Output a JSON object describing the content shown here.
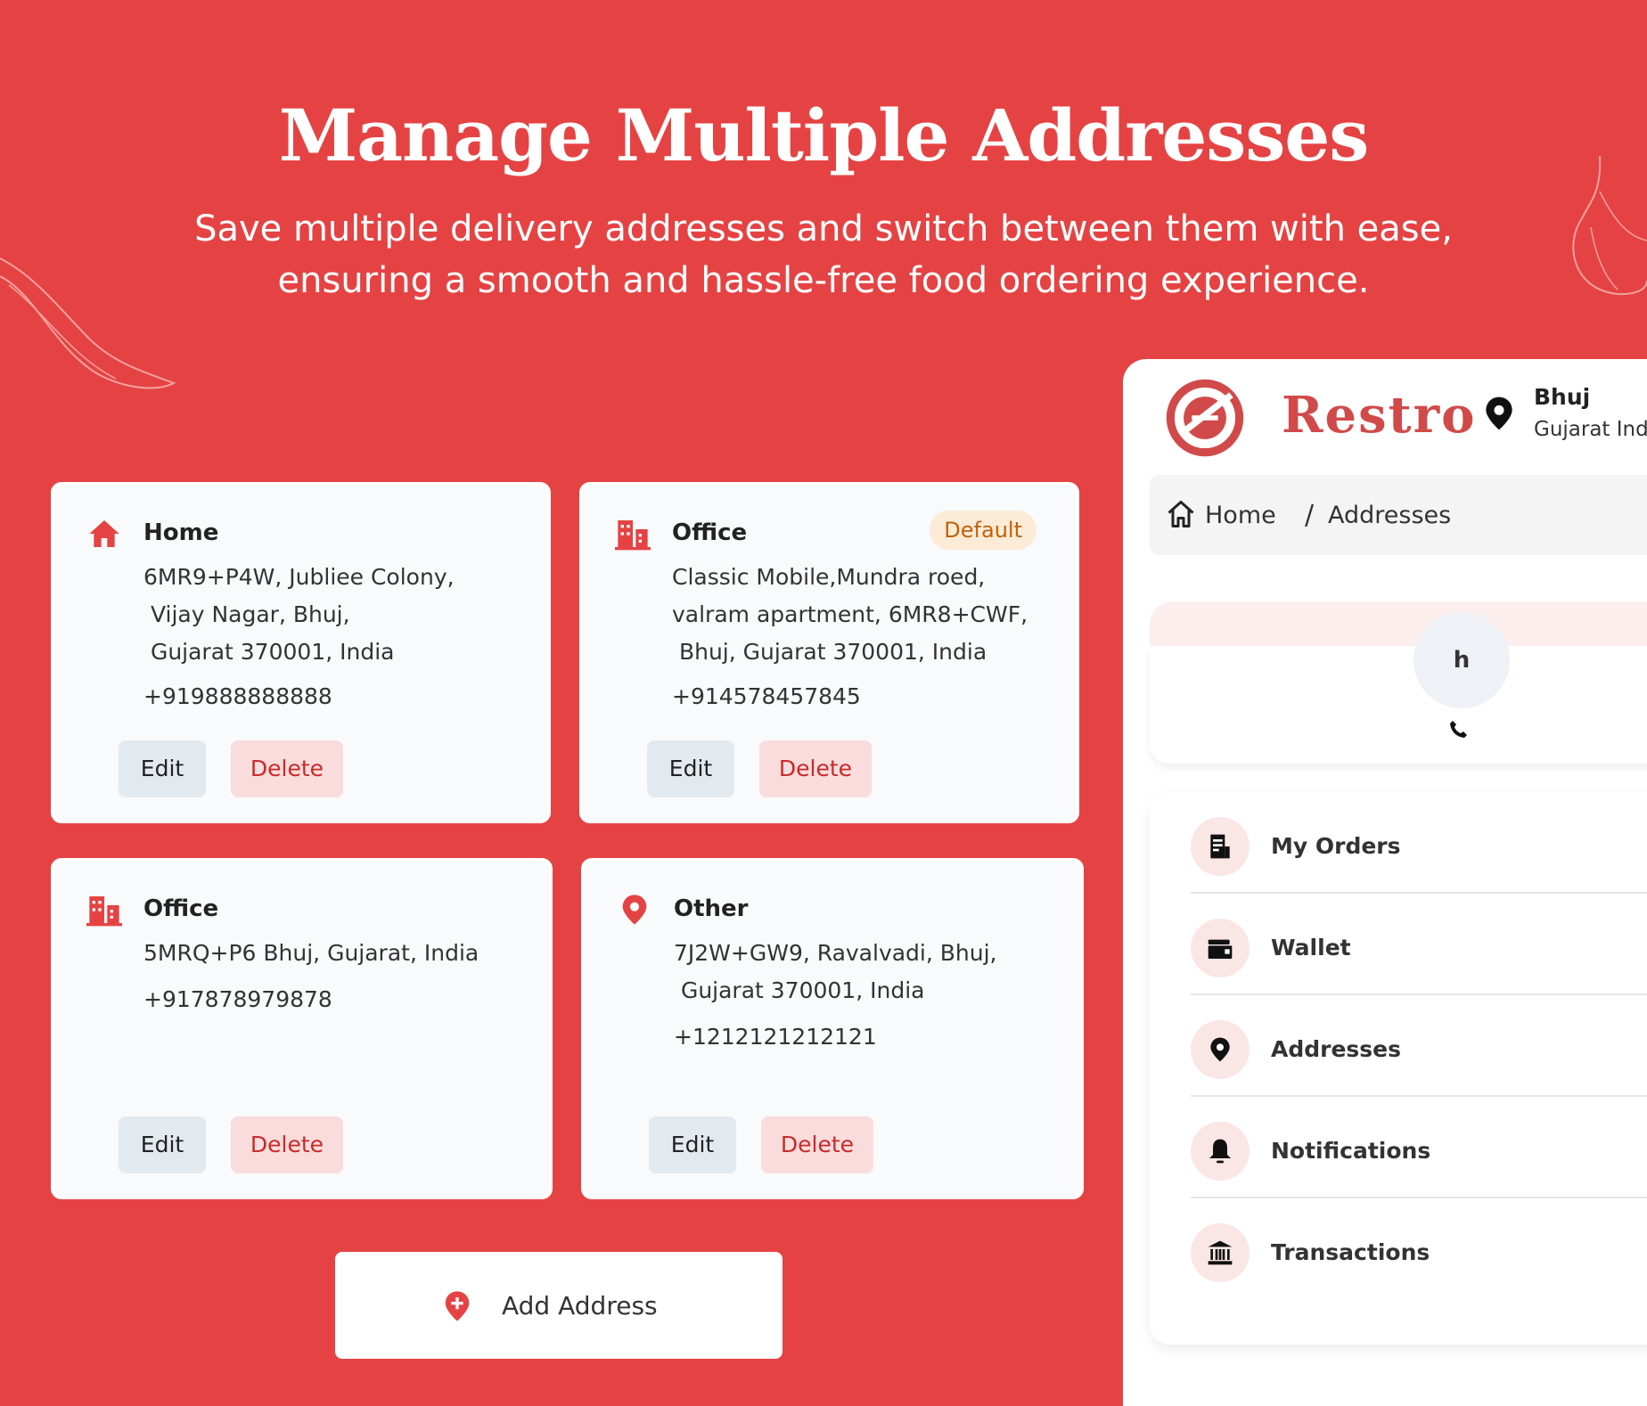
{
  "hero": {
    "title": "Manage Multiple Addresses",
    "subtitle_line1": "Save multiple delivery addresses and switch between them with ease,",
    "subtitle_line2": "ensuring a smooth and hassle-free food ordering experience."
  },
  "addresses": [
    {
      "label": "Home",
      "icon": "home-icon",
      "lines": "6MR9+P4W, Jubliee Colony,\n Vijay Nagar, Bhuj,\n Gujarat 370001, India",
      "phone": "+919888888888",
      "default": false
    },
    {
      "label": "Office",
      "icon": "office-building-icon",
      "lines": "Classic Mobile,Mundra roed,\nvalram apartment, 6MR8+CWF,\n Bhuj, Gujarat 370001, India",
      "phone": "+914578457845",
      "default": true,
      "badge": "Default"
    },
    {
      "label": "Office",
      "icon": "office-building-icon",
      "lines": "5MRQ+P6 Bhuj, Gujarat, India",
      "phone": "+917878979878",
      "default": false
    },
    {
      "label": "Other",
      "icon": "location-pin-icon",
      "lines": "7J2W+GW9, Ravalvadi, Bhuj,\n Gujarat 370001, India",
      "phone": "+1212121212121",
      "default": false
    }
  ],
  "actions": {
    "edit": "Edit",
    "delete": "Delete",
    "add_address": "Add Address"
  },
  "panel": {
    "brand": "Restro",
    "location_city": "Bhuj",
    "location_region": "Gujarat  India",
    "breadcrumb_home": "Home",
    "breadcrumb_sep": "/",
    "breadcrumb_current": "Addresses",
    "avatar_initial": "h",
    "menu": [
      {
        "label": "My Orders",
        "icon": "orders-icon"
      },
      {
        "label": "Wallet",
        "icon": "wallet-icon"
      },
      {
        "label": "Addresses",
        "icon": "location-pin-icon"
      },
      {
        "label": "Notifications",
        "icon": "bell-icon"
      },
      {
        "label": "Transactions",
        "icon": "bank-icon"
      }
    ]
  },
  "colors": {
    "background": "#E54343",
    "card": "#F8FAFC",
    "accent": "#E54343",
    "delete_bg": "#FADCDC",
    "edit_bg": "#E3EAEF",
    "badge_bg": "#FCEBD6"
  }
}
